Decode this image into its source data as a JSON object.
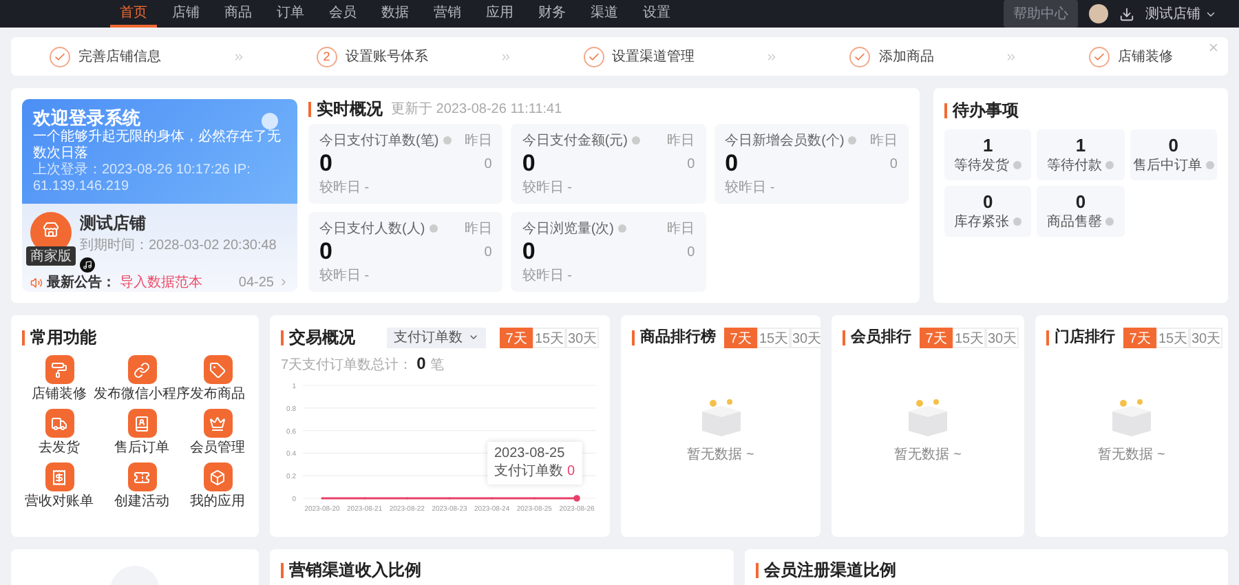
{
  "nav": {
    "items": [
      {
        "label": "首页",
        "selected": true
      },
      {
        "label": "店铺",
        "selected": false
      },
      {
        "label": "商品",
        "selected": false
      },
      {
        "label": "订单",
        "selected": false
      },
      {
        "label": "会员",
        "selected": false
      },
      {
        "label": "数据",
        "selected": false
      },
      {
        "label": "营销",
        "selected": false
      },
      {
        "label": "应用",
        "selected": false
      },
      {
        "label": "财务",
        "selected": false
      },
      {
        "label": "渠道",
        "selected": false
      },
      {
        "label": "设置",
        "selected": false
      }
    ],
    "help_button": "帮助中心",
    "account": "测试店铺"
  },
  "steps": [
    {
      "label": "完善店铺信息",
      "done": true
    },
    {
      "label": "设置账号体系",
      "done": false,
      "number": "2"
    },
    {
      "label": "设置渠道管理",
      "done": true
    },
    {
      "label": "添加商品",
      "done": true
    },
    {
      "label": "店铺装修",
      "done": true
    }
  ],
  "welcome": {
    "title": "欢迎登录系统",
    "motto": "一个能够升起无限的身体，必然存在了无数次日落",
    "last_login": "上次登录：2023-08-26 10:17:26 IP: 61.139.146.219"
  },
  "shop": {
    "name": "测试店铺",
    "expiry": "到期时间：2028-03-02 20:30:48",
    "badge": "商家版"
  },
  "notice": {
    "label": "最新公告：",
    "text": "导入数据范本",
    "date": "04-25"
  },
  "realtime": {
    "title": "实时概况",
    "updated": "更新于 2023-08-26 11:11:41",
    "cards": [
      {
        "label": "今日支付订单数(笔)",
        "value": "0",
        "yesterday_label": "昨日",
        "yesterday_value": "0",
        "compare": "较昨日 -"
      },
      {
        "label": "今日支付金额(元)",
        "value": "0",
        "yesterday_label": "昨日",
        "yesterday_value": "0",
        "compare": "较昨日 -"
      },
      {
        "label": "今日新增会员数(个)",
        "value": "0",
        "yesterday_label": "昨日",
        "yesterday_value": "0",
        "compare": "较昨日 -"
      },
      {
        "label": "今日支付人数(人)",
        "value": "0",
        "yesterday_label": "昨日",
        "yesterday_value": "0",
        "compare": "较昨日 -"
      },
      {
        "label": "今日浏览量(次)",
        "value": "0",
        "yesterday_label": "昨日",
        "yesterday_value": "0",
        "compare": "较昨日 -"
      }
    ]
  },
  "todo": {
    "title": "待办事项",
    "items": [
      {
        "value": "1",
        "label": "等待发货"
      },
      {
        "value": "1",
        "label": "等待付款"
      },
      {
        "value": "0",
        "label": "售后中订单"
      },
      {
        "value": "0",
        "label": "库存紧张"
      },
      {
        "value": "0",
        "label": "商品售罄"
      }
    ]
  },
  "shortcuts": {
    "title": "常用功能",
    "items": [
      {
        "label": "店铺装修"
      },
      {
        "label": "发布微信小程序"
      },
      {
        "label": "发布商品"
      },
      {
        "label": "去发货"
      },
      {
        "label": "售后订单"
      },
      {
        "label": "会员管理"
      },
      {
        "label": "营收对账单"
      },
      {
        "label": "创建活动"
      },
      {
        "label": "我的应用"
      }
    ]
  },
  "trade": {
    "title": "交易概况",
    "select": "支付订单数",
    "ranges": [
      {
        "label": "7天",
        "selected": true
      },
      {
        "label": "15天",
        "selected": false
      },
      {
        "label": "30天",
        "selected": false
      }
    ],
    "total_label": "7天支付订单数总计：",
    "total": "0",
    "total_unit": "笔",
    "chart_data": {
      "type": "line",
      "categories": [
        "2023-08-20",
        "2023-08-21",
        "2023-08-22",
        "2023-08-23",
        "2023-08-24",
        "2023-08-25",
        "2023-08-26"
      ],
      "series": [
        {
          "name": "支付订单数",
          "color": "#e8406a",
          "values": [
            0,
            0,
            0,
            0,
            0,
            0,
            0
          ]
        }
      ],
      "ylim": [
        0,
        1
      ],
      "yticks": [
        0,
        0.2,
        0.4,
        0.6,
        0.8,
        1
      ],
      "grid": true
    },
    "tooltip": {
      "date": "2023-08-25",
      "value": "0"
    }
  },
  "rankings": [
    {
      "title": "商品排行榜",
      "ranges": [
        {
          "label": "7天",
          "selected": true
        },
        {
          "label": "15天",
          "selected": false
        },
        {
          "label": "30天",
          "selected": false
        }
      ],
      "empty": "暂无数据 ~"
    },
    {
      "title": "会员排行",
      "ranges": [
        {
          "label": "7天",
          "selected": true
        },
        {
          "label": "15天",
          "selected": false
        },
        {
          "label": "30天",
          "selected": false
        }
      ],
      "empty": "暂无数据 ~"
    },
    {
      "title": "门店排行",
      "ranges": [
        {
          "label": "7天",
          "selected": true
        },
        {
          "label": "15天",
          "selected": false
        },
        {
          "label": "30天",
          "selected": false
        }
      ],
      "empty": "暂无数据 ~"
    }
  ],
  "bottom": {
    "panels": [
      {
        "title": "营销渠道收入比例"
      },
      {
        "title": "会员注册渠道比例"
      }
    ]
  }
}
